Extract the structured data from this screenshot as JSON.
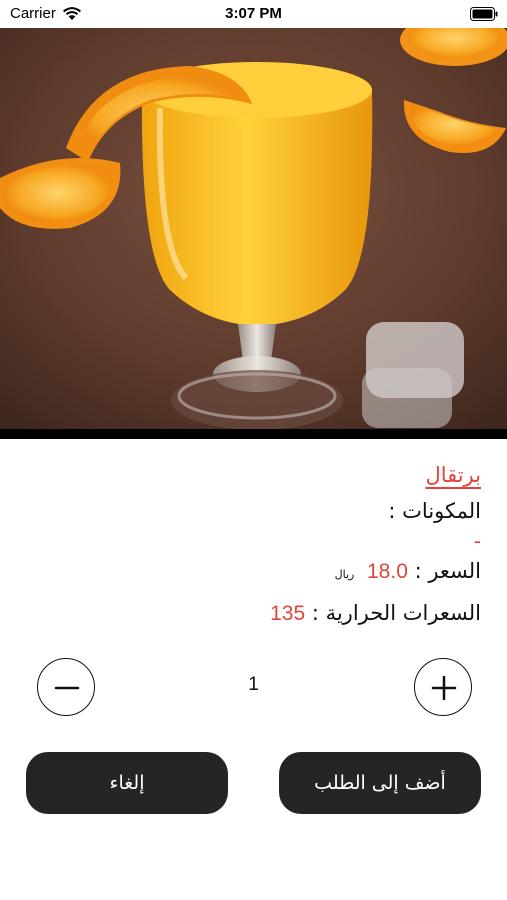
{
  "status_bar": {
    "carrier": "Carrier",
    "time": "3:07 PM",
    "wifi_icon": "wifi-icon",
    "battery_icon": "battery-icon"
  },
  "hero": {
    "image": "orange-juice-photo",
    "colors": {
      "juice": "#f6b51c",
      "orange": "#f59a1b",
      "background": "#5b3a2c"
    }
  },
  "item": {
    "name": "برتقال",
    "ingredients_label": "المكونات :",
    "ingredients_value": "-",
    "price_label": "السعر :",
    "price_value": "18.0",
    "currency": "ريال",
    "calories_label": "السعرات الحرارية :",
    "calories_value": "135"
  },
  "quantity": {
    "value": "1",
    "minus_icon": "minus-icon",
    "plus_icon": "plus-icon"
  },
  "actions": {
    "add_label": "أضف إلى الطلب",
    "cancel_label": "إلغاء"
  },
  "theme": {
    "accent": "#e0453a",
    "button_bg": "#252525",
    "button_text": "#ffffff"
  }
}
